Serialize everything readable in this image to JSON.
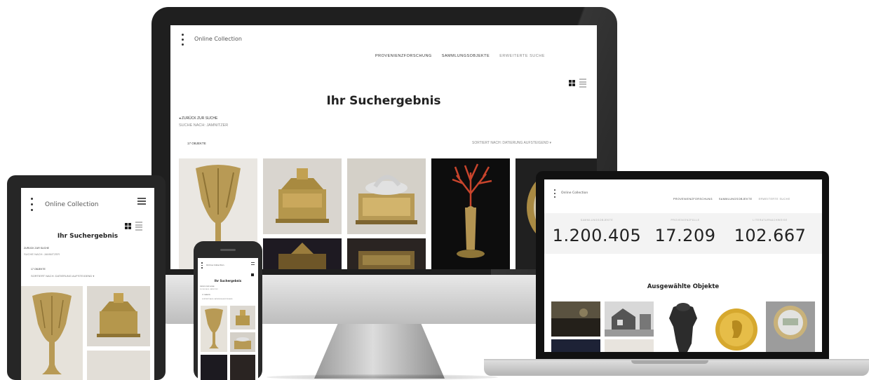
{
  "site": {
    "logo": "Online Collection",
    "nav": [
      "Provenienzforschung",
      "Sammlungsobjekte",
      "Erweiterte Suche"
    ],
    "results_title": "Ihr Suchergebnis",
    "back_link": "Zurück zur Suche",
    "search_query": "Suche nach: Jamnitzer",
    "object_count": "17 Objekte",
    "sort_label": "Sortiert nach: Datierung aufsteigend"
  },
  "laptop": {
    "stats": [
      {
        "label": "Sammlungsobjekte",
        "value": "1.200.405"
      },
      {
        "label": "Provenienzfälle",
        "value": "17.209"
      },
      {
        "label": "Literaturnachweise",
        "value": "102.667"
      }
    ],
    "featured_title": "Ausgewählte Objekte"
  },
  "colors": {
    "device_frame": "#1f1f1f",
    "gold": "#b89a55",
    "coral": "#c8442c"
  }
}
